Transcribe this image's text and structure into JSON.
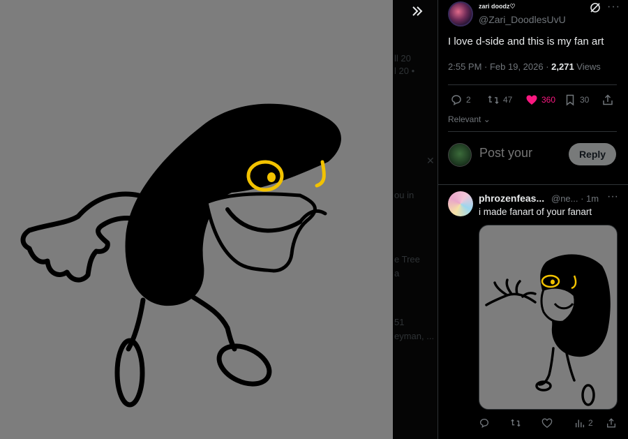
{
  "viewer": {
    "image_label": "d-side fan art drawing",
    "collapse_icon": "double-chevron-right-icon"
  },
  "background_timeline": {
    "snippets": [
      "ll 20",
      "l 20 •",
      "ou in",
      "e Tree",
      "a",
      "51",
      "eyman, ..."
    ]
  },
  "post": {
    "author_name": "zari doodz♡",
    "author_handle": "@Zari_DoodlesUvU",
    "text": "I love d-side and this is my fan art",
    "time": "2:55 PM · Feb 19, 2026 · ",
    "views_count": "2,271",
    "views_label": " Views",
    "actions": {
      "replies": "2",
      "reposts": "47",
      "likes": "360",
      "bookmarks": "30"
    },
    "like_color": "#f91880"
  },
  "sort": {
    "label": "Relevant"
  },
  "composer": {
    "placeholder": "Post your",
    "button_label": "Reply"
  },
  "reply": {
    "name": "phrozenfeas...",
    "handle": "@ne... · 1m",
    "text": "i made fanart of your fanart",
    "media_label": "fan art of fan art drawing",
    "actions": {
      "views": "2"
    }
  },
  "colors": {
    "viewer_bg": "#7d7d7d",
    "accent_pink": "#f91880",
    "muted": "#71767b"
  }
}
